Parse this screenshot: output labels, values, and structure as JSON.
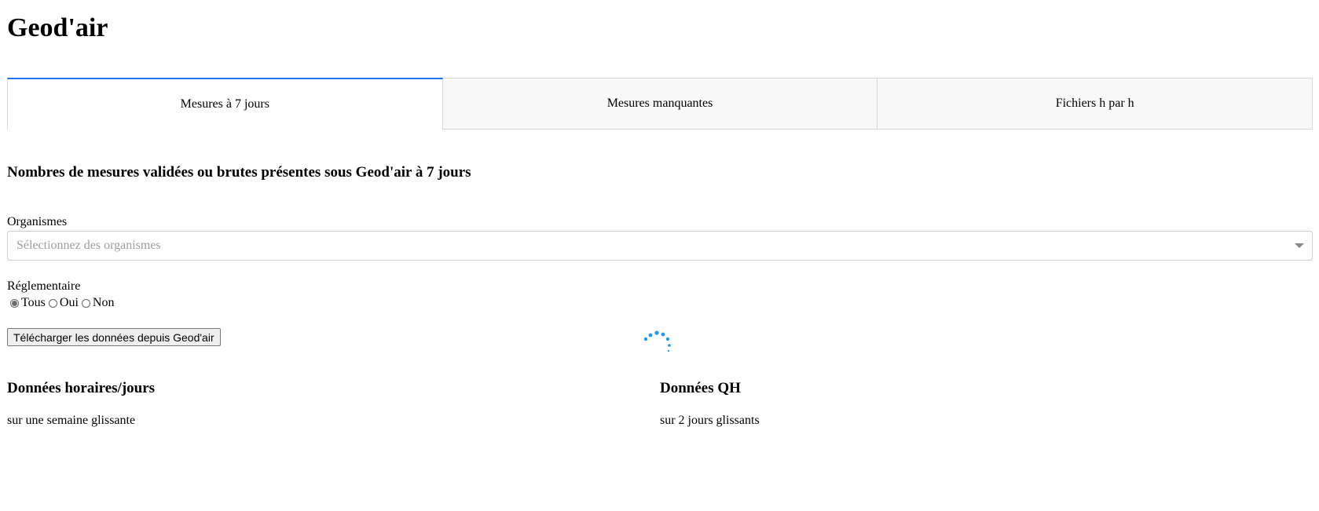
{
  "app": {
    "title": "Geod'air"
  },
  "tabs": [
    {
      "label": "Mesures à 7 jours",
      "active": true
    },
    {
      "label": "Mesures manquantes",
      "active": false
    },
    {
      "label": "Fichiers h par h",
      "active": false
    }
  ],
  "main": {
    "title": "Nombres de mesures validées ou brutes présentes sous Geod'air à 7 jours",
    "organismes": {
      "label": "Organismes",
      "placeholder": "Sélectionnez des organismes"
    },
    "reglementaire": {
      "label": "Réglementaire",
      "options": [
        "Tous",
        "Oui",
        "Non"
      ],
      "selected": "Tous"
    },
    "download_button": "Télécharger les données depuis Geod'air",
    "left_panel": {
      "title": "Données horaires/jours",
      "subtitle": "sur une semaine glissante"
    },
    "right_panel": {
      "title": "Données QH",
      "subtitle": "sur 2 jours glissants"
    }
  },
  "colors": {
    "accent": "#1a73e8",
    "spinner": "#1e9cf0"
  }
}
